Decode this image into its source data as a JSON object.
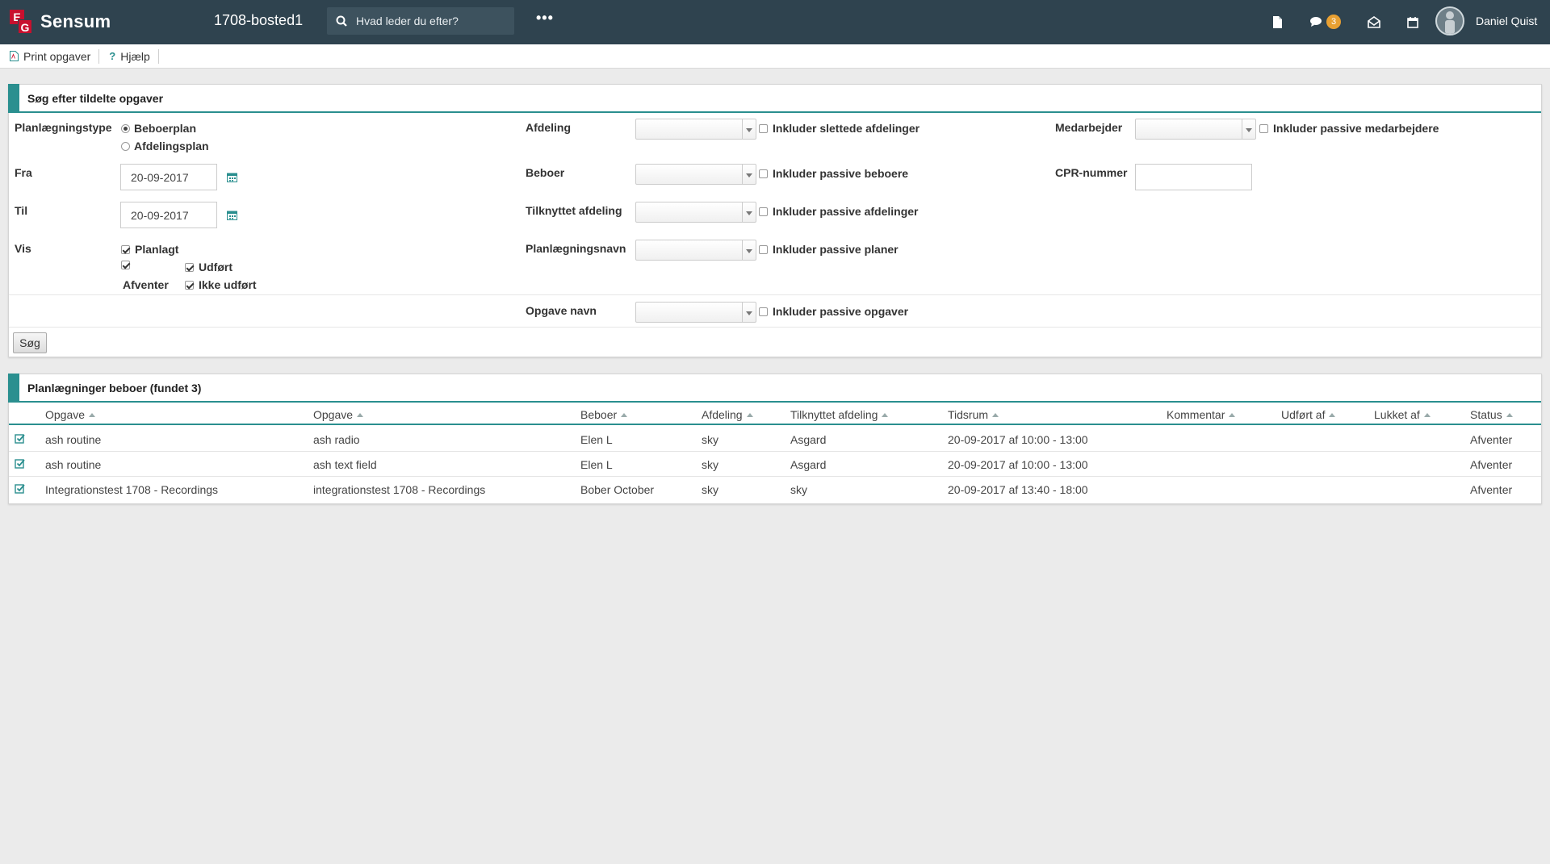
{
  "app": {
    "brand": "Sensum",
    "logo_letters": [
      "E",
      "G"
    ],
    "site": "1708-bosted1",
    "search_placeholder": "Hvad leder du efter?",
    "more": "•••",
    "message_count": "3",
    "user_name": "Daniel Quist",
    "accent_color": "#2a8f8f",
    "navbar_color": "#2f434f",
    "badge_color": "#e8a032"
  },
  "toolbar": {
    "print_label": "Print opgaver",
    "help_label": "Hjælp",
    "help_glyph": "?"
  },
  "search_panel": {
    "title": "Søg efter tildelte opgaver",
    "plan_type_label": "Planlægningstype",
    "plan_types": [
      "Beboerplan",
      "Afdelingsplan"
    ],
    "selected_plan_type": "Beboerplan",
    "from_label": "Fra",
    "from_value": "20-09-2017",
    "to_label": "Til",
    "to_value": "20-09-2017",
    "show_label": "Vis",
    "show_options": {
      "planlagt": {
        "label": "Planlagt",
        "checked": true
      },
      "afventer": {
        "label": "Afventer",
        "checked": true
      },
      "udfort": {
        "label": "Udført",
        "checked": true
      },
      "ikke_udfort": {
        "label": "Ikke udført",
        "checked": true
      }
    },
    "department_label": "Afdeling",
    "include_deleted_departments": "Inkluder slettede afdelinger",
    "resident_label": "Beboer",
    "include_passive_residents": "Inkluder passive beboere",
    "attached_department_label": "Tilknyttet afdeling",
    "include_passive_departments": "Inkluder passive afdelinger",
    "plan_name_label": "Planlægningsnavn",
    "include_passive_plans": "Inkluder passive planer",
    "task_name_label": "Opgave navn",
    "include_passive_tasks": "Inkluder passive opgaver",
    "employee_label": "Medarbejder",
    "include_passive_employees": "Inkluder passive medarbejdere",
    "cpr_label": "CPR-nummer",
    "search_button": "Søg"
  },
  "results_panel": {
    "title": "Planlægninger beboer (fundet 3)",
    "columns": [
      "Opgave",
      "Opgave",
      "Beboer",
      "Afdeling",
      "Tilknyttet afdeling",
      "Tidsrum",
      "Kommentar",
      "Udført af",
      "Lukket af",
      "Status"
    ],
    "rows": [
      [
        "ash routine",
        "ash radio",
        "Elen L",
        "sky",
        "Asgard",
        "20-09-2017 af 10:00 - 13:00",
        "",
        "",
        "",
        "Afventer"
      ],
      [
        "ash routine",
        "ash text field",
        "Elen L",
        "sky",
        "Asgard",
        "20-09-2017 af 10:00 - 13:00",
        "",
        "",
        "",
        "Afventer"
      ],
      [
        "Integrationstest 1708 - Recordings",
        "integrationstest 1708 - Recordings",
        "Bober October",
        "sky",
        "sky",
        "20-09-2017 af 13:40 - 18:00",
        "",
        "",
        "",
        "Afventer"
      ]
    ]
  }
}
